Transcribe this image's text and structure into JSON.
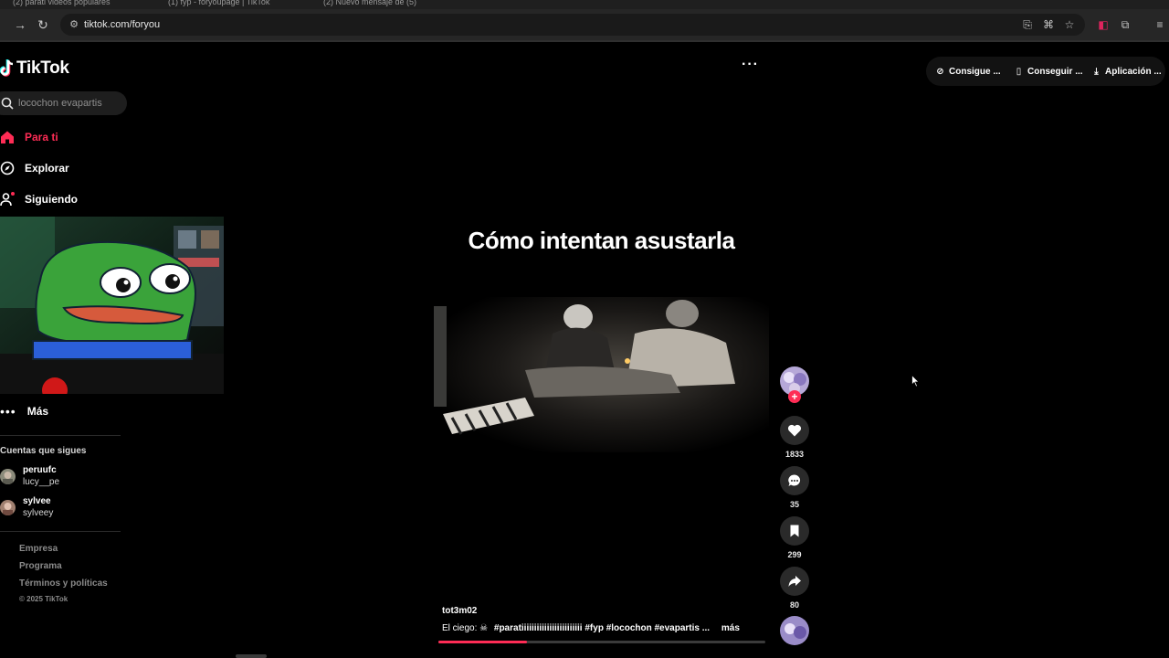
{
  "browser": {
    "tabs": [
      "(2) parati videos populares",
      "(1) fyp - foryoupage | TikTok",
      "(2) Nuevo mensaje de (5)"
    ],
    "url": "tiktok.com/foryou"
  },
  "sidebar": {
    "logo": "TikTok",
    "search_placeholder": "locochon evapartis",
    "nav": [
      {
        "label": "Para ti",
        "icon": "home-icon"
      },
      {
        "label": "Explorar",
        "icon": "compass-icon"
      },
      {
        "label": "Siguiendo",
        "icon": "following-icon"
      }
    ],
    "more_label": "Más",
    "following_title": "Cuentas que sigues",
    "accounts": [
      {
        "name": "peruufc",
        "handle": "lucy__pe"
      },
      {
        "name": "sylvee",
        "handle": "sylveey"
      }
    ],
    "footer": [
      "Empresa",
      "Programa",
      "Términos y políticas"
    ],
    "copyright": "© 2025 TikTok"
  },
  "header": {
    "actions": [
      {
        "label": "Consigue ...",
        "icon": "coin-icon"
      },
      {
        "label": "Conseguir ...",
        "icon": "phone-icon"
      },
      {
        "label": "Aplicación ...",
        "icon": "download-icon"
      }
    ]
  },
  "video": {
    "caption": "Cómo intentan asustarla",
    "author": "tot3m02",
    "description": "El ciego: ☠",
    "hashtags": "#paratiiiiiiiiiiiiiiiiiiiiiiii #fyp #locochon #evapartis ...",
    "more": "más",
    "progress": 0.27
  },
  "actions": {
    "likes": "1833",
    "comments": "35",
    "saves": "299",
    "shares": "80"
  },
  "colors": {
    "accent": "#fe2c55",
    "background": "#000000"
  }
}
